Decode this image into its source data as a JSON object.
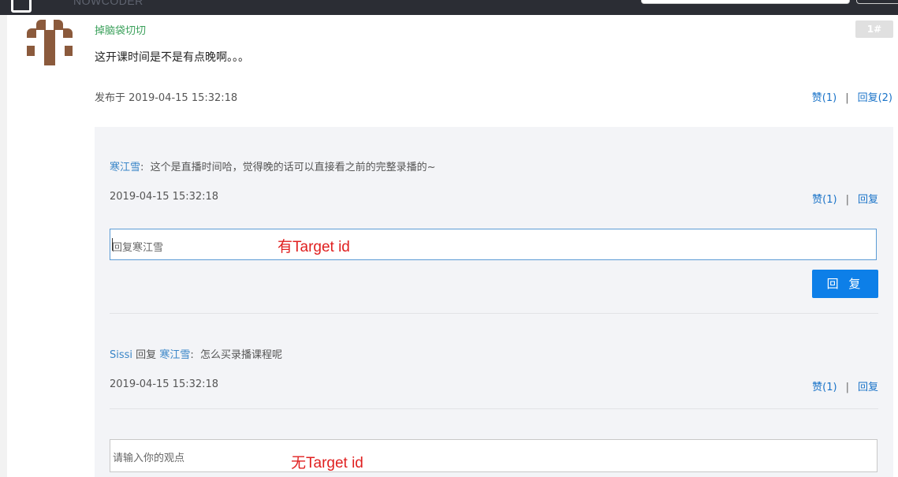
{
  "nav": {
    "brand": "NOWCODER"
  },
  "post": {
    "author": "掉脑袋切切",
    "floor": "1#",
    "content": "这开课时间是不是有点晚啊。。。",
    "date": "发布于 2019-04-15 15:32:18",
    "like": "赞(1)",
    "sep": "|",
    "reply": "回复(2)"
  },
  "replies": [
    {
      "user": "寒江雪",
      "colon": ":",
      "text": "这个是直播时间哈，觉得晚的话可以直接看之前的完整录播的~",
      "date": "2019-04-15 15:32:18",
      "like": "赞(1)",
      "sep": "|",
      "reply": "回复"
    },
    {
      "user": "Sissi",
      "reply_word": "回复",
      "target": "寒江雪",
      "colon": ":",
      "text": "怎么买录播课程呢",
      "date": "2019-04-15 15:32:18",
      "like": "赞(1)",
      "sep": "|",
      "reply": "回复"
    }
  ],
  "reply_input": {
    "placeholder": "回复寒江雪",
    "annotation": "有Target id"
  },
  "reply_button": "回 复",
  "view_input": {
    "placeholder": "请输入你的观点",
    "annotation": "无Target id"
  }
}
